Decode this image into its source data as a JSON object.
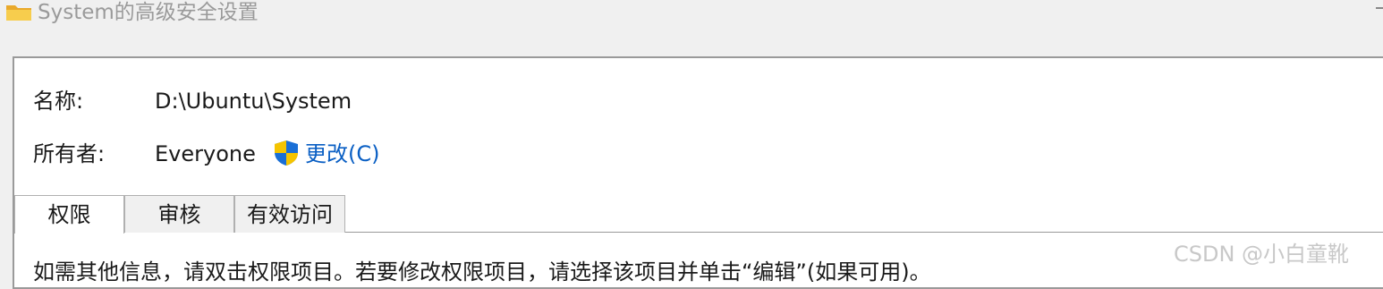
{
  "window": {
    "title": "System的高级安全设置",
    "icon": "folder-icon"
  },
  "fields": {
    "name_label": "名称:",
    "name_value": "D:\\Ubuntu\\System",
    "owner_label": "所有者:",
    "owner_value": "Everyone",
    "change_label": "更改(C)",
    "change_icon": "uac-shield-icon"
  },
  "tabs": [
    {
      "label": "权限",
      "active": true
    },
    {
      "label": "审核",
      "active": false
    },
    {
      "label": "有效访问",
      "active": false
    }
  ],
  "content": {
    "info_text": "如需其他信息，请双击权限项目。若要修改权限项目，请选择该项目并单击“编辑”(如果可用)。"
  },
  "watermark": "CSDN @小白童靴",
  "colors": {
    "link": "#0a5fc4",
    "folder": "#f3c13a",
    "shield_blue": "#1a6fd6",
    "shield_yellow": "#f5c400"
  }
}
